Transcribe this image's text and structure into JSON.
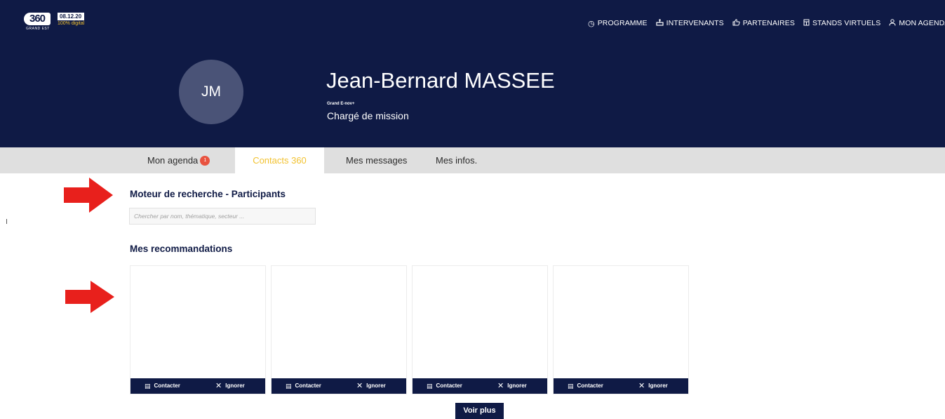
{
  "brand": {
    "logo": "360",
    "logo_sub": "GRAND EST",
    "date": "08.12.20",
    "tagline": "100% digital"
  },
  "nav": {
    "items": [
      {
        "label": "PROGRAMME",
        "icon": "clock-icon"
      },
      {
        "label": "INTERVENANTS",
        "icon": "podium-icon"
      },
      {
        "label": "PARTENAIRES",
        "icon": "thumbs-up-icon"
      },
      {
        "label": "STANDS VIRTUELS",
        "icon": "stand-icon"
      },
      {
        "label": "MON AGENDA",
        "icon": "user-icon"
      }
    ]
  },
  "profile": {
    "initials": "JM",
    "name": "Jean-Bernard MASSEE",
    "organization": "Grand E-nov+",
    "role": "Chargé de mission"
  },
  "tabs": [
    {
      "label": "Mon agenda",
      "badge": "1"
    },
    {
      "label": "Contacts 360",
      "active": true
    },
    {
      "label": "Mes messages"
    },
    {
      "label": "Mes infos."
    }
  ],
  "search": {
    "title": "Moteur de recherche - Participants",
    "placeholder": "Chercher par nom, thématique, secteur ..."
  },
  "recommendations": {
    "title": "Mes recommandations",
    "contact_label": "Contacter",
    "ignore_label": "Ignorer",
    "more_label": "Voir plus"
  },
  "colors": {
    "navy": "#0f1a45",
    "accent_yellow": "#f2c230",
    "badge_red": "#e8523f",
    "arrow_red": "#e8201c"
  }
}
